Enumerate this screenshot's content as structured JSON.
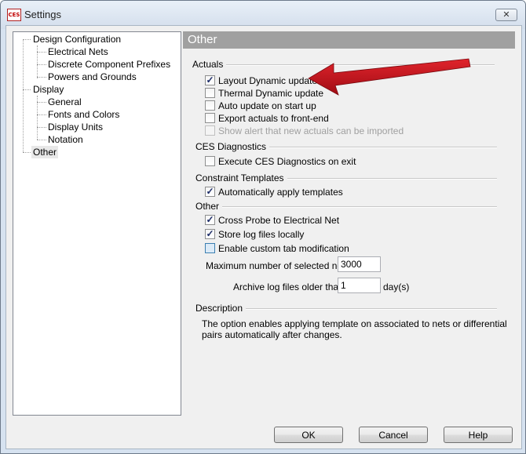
{
  "window": {
    "title": "Settings",
    "app_icon_text": "CES",
    "close_glyph": "✕"
  },
  "tree": {
    "items": [
      {
        "label": "Design Configuration",
        "level": 0
      },
      {
        "label": "Electrical Nets",
        "level": 1
      },
      {
        "label": "Discrete Component Prefixes",
        "level": 1
      },
      {
        "label": "Powers and Grounds",
        "level": 1
      },
      {
        "label": "Display",
        "level": 0
      },
      {
        "label": "General",
        "level": 1
      },
      {
        "label": "Fonts and Colors",
        "level": 1
      },
      {
        "label": "Display Units",
        "level": 1
      },
      {
        "label": "Notation",
        "level": 1
      },
      {
        "label": "Other",
        "level": 0,
        "selected": true
      }
    ]
  },
  "panel": {
    "title": "Other",
    "actuals": {
      "label": "Actuals",
      "options": [
        {
          "label": "Layout Dynamic update",
          "checked": true
        },
        {
          "label": "Thermal Dynamic update",
          "checked": false
        },
        {
          "label": "Auto update on start up",
          "checked": false
        },
        {
          "label": "Export actuals to front-end",
          "checked": false
        },
        {
          "label": "Show alert that new actuals can be imported",
          "checked": false,
          "disabled": true
        }
      ]
    },
    "diagnostics": {
      "label": "CES Diagnostics",
      "options": [
        {
          "label": "Execute CES Diagnostics on exit",
          "checked": false
        }
      ]
    },
    "templates": {
      "label": "Constraint Templates",
      "options": [
        {
          "label": "Automatically apply templates",
          "checked": true
        }
      ]
    },
    "other": {
      "label": "Other",
      "options": [
        {
          "label": "Cross Probe to Electrical Net",
          "checked": true
        },
        {
          "label": "Store log files locally",
          "checked": true
        },
        {
          "label": "Enable custom tab modification",
          "checked": false
        }
      ],
      "max_nets_label": "Maximum number of selected nets:",
      "max_nets_value": "3000",
      "archive_label": "Archive log files older than:",
      "archive_value": "1",
      "archive_unit": "day(s)"
    },
    "description": {
      "label": "Description",
      "text": "The option enables applying template on associated to nets or differential pairs automatically after changes."
    }
  },
  "buttons": {
    "ok": "OK",
    "cancel": "Cancel",
    "help": "Help"
  },
  "colors": {
    "annotation_arrow": "#c8141e",
    "panel_header_bg": "#a0a0a0"
  }
}
